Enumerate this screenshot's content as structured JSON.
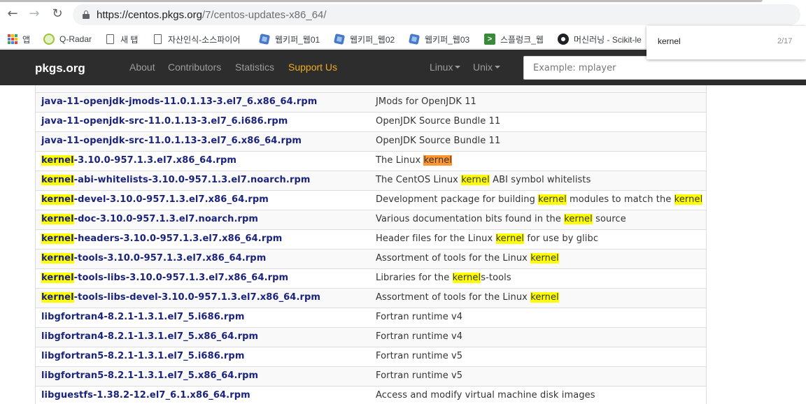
{
  "browser": {
    "url_host": "https://centos.pkgs.org",
    "url_path": "/7/centos-updates-x86_64/",
    "back_icon": "arrow-left-icon",
    "forward_icon": "arrow-right-icon",
    "reload_icon": "reload-icon",
    "lock_icon": "lock-icon"
  },
  "bookmarks": [
    {
      "label": "앱",
      "icon": "apps-grid-icon"
    },
    {
      "label": "Q-Radar",
      "icon": "qradar-icon"
    },
    {
      "label": "새 탭",
      "icon": "page-icon"
    },
    {
      "label": "자산인식-소스파이어",
      "icon": "page-icon"
    },
    {
      "label": "웹키퍼_웹01",
      "icon": "cube-icon"
    },
    {
      "label": "웹키퍼_웹02",
      "icon": "cube-icon"
    },
    {
      "label": "웹키퍼_웹03",
      "icon": "cube-icon"
    },
    {
      "label": "스플렁크_웹",
      "icon": "prompt-icon"
    },
    {
      "label": "머신러닝 - Scikit-le",
      "icon": "github-icon"
    }
  ],
  "find": {
    "query": "kernel",
    "count": "2/17"
  },
  "navbar": {
    "brand": "pkgs.org",
    "links": [
      "About",
      "Contributors",
      "Statistics",
      "Support Us"
    ],
    "linux": "Linux",
    "unix": "Unix",
    "search_placeholder": "Example: mplayer",
    "accent_color": "#f0ad1e",
    "bg_color": "#2d2d2d"
  },
  "highlight": {
    "term": "kernel",
    "color": "#ffff00",
    "current_color": "#ff9632"
  },
  "packages": [
    {
      "name": "java-11-openjdk-jmods-11.0.1.13-3.el7_6.x86_64.rpm",
      "desc": "JMods for OpenJDK 11"
    },
    {
      "name": "java-11-openjdk-src-11.0.1.13-3.el7_6.i686.rpm",
      "desc": "OpenJDK Source Bundle 11"
    },
    {
      "name": "java-11-openjdk-src-11.0.1.13-3.el7_6.x86_64.rpm",
      "desc": "OpenJDK Source Bundle 11"
    },
    {
      "name": "kernel-3.10.0-957.1.3.el7.x86_64.rpm",
      "desc": "The Linux kernel"
    },
    {
      "name": "kernel-abi-whitelists-3.10.0-957.1.3.el7.noarch.rpm",
      "desc": "The CentOS Linux kernel ABI symbol whitelists"
    },
    {
      "name": "kernel-devel-3.10.0-957.1.3.el7.x86_64.rpm",
      "desc": "Development package for building kernel modules to match the kernel"
    },
    {
      "name": "kernel-doc-3.10.0-957.1.3.el7.noarch.rpm",
      "desc": "Various documentation bits found in the kernel source"
    },
    {
      "name": "kernel-headers-3.10.0-957.1.3.el7.x86_64.rpm",
      "desc": "Header files for the Linux kernel for use by glibc"
    },
    {
      "name": "kernel-tools-3.10.0-957.1.3.el7.x86_64.rpm",
      "desc": "Assortment of tools for the Linux kernel"
    },
    {
      "name": "kernel-tools-libs-3.10.0-957.1.3.el7.x86_64.rpm",
      "desc": "Libraries for the kernels-tools"
    },
    {
      "name": "kernel-tools-libs-devel-3.10.0-957.1.3.el7.x86_64.rpm",
      "desc": "Assortment of tools for the Linux kernel"
    },
    {
      "name": "libgfortran4-8.2.1-1.3.1.el7_5.i686.rpm",
      "desc": "Fortran runtime v4"
    },
    {
      "name": "libgfortran4-8.2.1-1.3.1.el7_5.x86_64.rpm",
      "desc": "Fortran runtime v4"
    },
    {
      "name": "libgfortran5-8.2.1-1.3.1.el7_5.i686.rpm",
      "desc": "Fortran runtime v5"
    },
    {
      "name": "libgfortran5-8.2.1-1.3.1.el7_5.x86_64.rpm",
      "desc": "Fortran runtime v5"
    },
    {
      "name": "libguestfs-1.38.2-12.el7_6.1.x86_64.rpm",
      "desc": "Access and modify virtual machine disk images"
    }
  ]
}
